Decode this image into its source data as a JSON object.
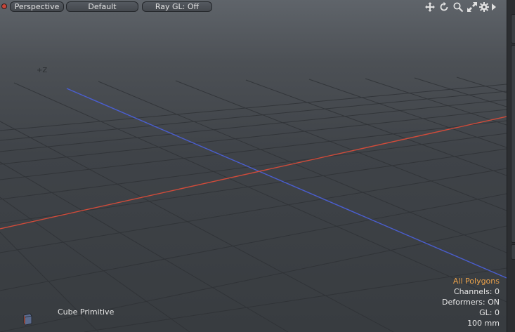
{
  "toolbar": {
    "view_type": "Perspective",
    "shading": "Default",
    "ray_gl": "Ray GL: Off",
    "icons": [
      "move-view-icon",
      "rotate-view-icon",
      "zoom-view-icon",
      "maximize-view-icon",
      "settings-gear-icon",
      "expand-arrow-icon"
    ]
  },
  "viewport": {
    "axis_label": "+Z",
    "x_axis_color": "#d14b3a",
    "z_axis_color": "#4a5ed0",
    "grid_color": "#2f3236",
    "background_top": "#5f646a",
    "background_bottom": "#383c40"
  },
  "info": {
    "selection_mode": "All Polygons",
    "channels": "Channels: 0",
    "deformers": "Deformers: ON",
    "gl": "GL: 0",
    "grid_size": "100 mm",
    "accent_color": "#e8a04a"
  },
  "item": {
    "name": "Cube Primitive",
    "icon": "cube-primitive-icon"
  }
}
